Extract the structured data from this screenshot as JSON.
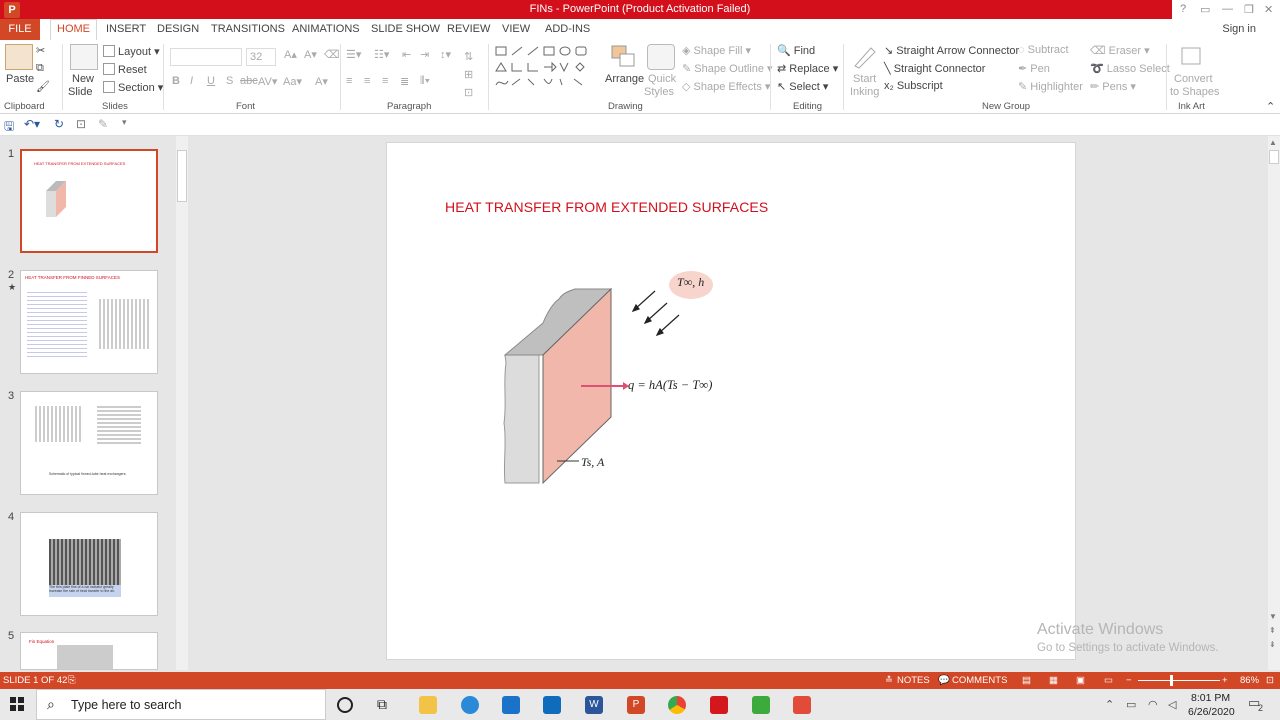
{
  "window": {
    "title": "FINs - PowerPoint (Product Activation Failed)",
    "signin": "Sign in"
  },
  "tabs": [
    "FILE",
    "HOME",
    "INSERT",
    "DESIGN",
    "TRANSITIONS",
    "ANIMATIONS",
    "SLIDE SHOW",
    "REVIEW",
    "VIEW",
    "ADD-INS"
  ],
  "ribbon": {
    "clipboard": {
      "paste": "Paste",
      "label": "Clipboard"
    },
    "slides": {
      "new_slide_line1": "New",
      "new_slide_line2": "Slide",
      "layout": "Layout",
      "reset": "Reset",
      "section": "Section",
      "label": "Slides"
    },
    "font": {
      "size": "32",
      "label": "Font"
    },
    "paragraph": {
      "label": "Paragraph"
    },
    "drawing": {
      "arrange": "Arrange",
      "quick_styles_1": "Quick",
      "quick_styles_2": "Styles",
      "shape_fill": "Shape Fill",
      "shape_outline": "Shape Outline",
      "shape_effects": "Shape Effects",
      "label": "Drawing"
    },
    "editing": {
      "find": "Find",
      "replace": "Replace",
      "select": "Select",
      "label": "Editing"
    },
    "newgroup": {
      "start_inking_1": "Start",
      "start_inking_2": "Inking",
      "straight_arrow": "Straight Arrow Connector",
      "straight_connector": "Straight Connector",
      "subscript": "Subscript",
      "subtract": "Subtract",
      "pen": "Pen",
      "highlighter": "Highlighter",
      "eraser": "Eraser",
      "lasso": "Lasso Select",
      "pens": "Pens",
      "label": "New Group"
    },
    "inkart": {
      "convert_1": "Convert",
      "convert_2": "to Shapes",
      "label": "Ink Art"
    }
  },
  "thumbnails": [
    {
      "num": "1",
      "title": "HEAT TRANSFER FROM EXTENDED SURFACES"
    },
    {
      "num": "2",
      "title": "HEAT TRANSFER FROM FINNED SURFACES"
    },
    {
      "num": "3",
      "caption": "Schematic of typical finned-tube heat exchangers."
    },
    {
      "num": "4",
      "caption": "The thin plate fins of a car radiator greatly increase the rate of heat transfer to the air."
    },
    {
      "num": "5",
      "title": "Fin Equation"
    }
  ],
  "slide": {
    "title": "HEAT TRANSFER FROM EXTENDED SURFACES",
    "fluid_label": "T∞, h",
    "equation": "q = hA(Ts − T∞)",
    "surface_label": "Ts, A"
  },
  "watermark": {
    "line1": "Activate Windows",
    "line2": "Go to Settings to activate Windows."
  },
  "status": {
    "slide_info": "SLIDE 1 OF 42",
    "notes": "NOTES",
    "comments": "COMMENTS",
    "zoom": "86%"
  },
  "taskbar": {
    "search_placeholder": "Type here to search",
    "time": "8:01 PM",
    "date": "6/26/2020",
    "notif_count": "2"
  },
  "colors": {
    "accent": "#d24726",
    "title_red": "#d20f1b",
    "plate": "#f2b7ab"
  }
}
